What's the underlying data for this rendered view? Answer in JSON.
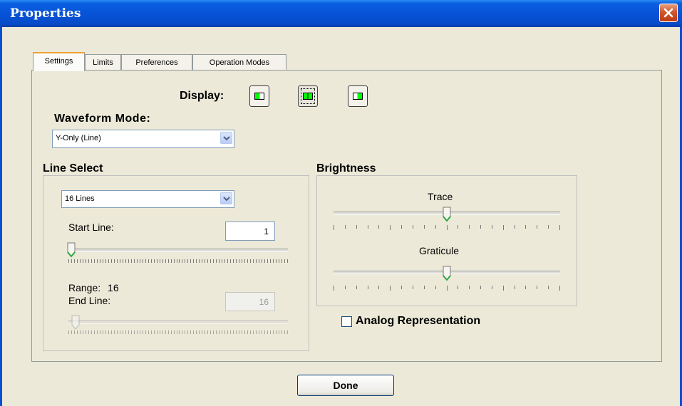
{
  "window": {
    "title": "Properties"
  },
  "tabs": [
    {
      "label": "Settings",
      "active": true
    },
    {
      "label": "Limits",
      "active": false
    },
    {
      "label": "Preferences",
      "active": false
    },
    {
      "label": "Operation Modes",
      "active": false
    }
  ],
  "display": {
    "label": "Display:",
    "options": [
      {
        "icon": "display-left-icon",
        "selected": false
      },
      {
        "icon": "display-split-icon",
        "selected": true
      },
      {
        "icon": "display-right-icon",
        "selected": false
      }
    ]
  },
  "waveform_mode": {
    "label": "Waveform Mode:",
    "value": "Y-Only (Line)"
  },
  "line_select": {
    "label": "Line Select",
    "combo_value": "16 Lines",
    "start_line_label": "Start Line:",
    "start_line_value": "1",
    "range_label": "Range:",
    "range_value": "16",
    "end_line_label": "End Line:",
    "end_line_value": "16",
    "start_slider_fraction": 0.0,
    "end_slider_fraction": 0.0
  },
  "brightness": {
    "label": "Brightness",
    "trace_label": "Trace",
    "trace_fraction": 0.5,
    "graticule_label": "Graticule",
    "graticule_fraction": 0.5
  },
  "analog": {
    "label": "Analog Representation",
    "checked": false
  },
  "done_label": "Done",
  "colors": {
    "titlebar": "#0753D8",
    "display_screen": "#00FF00",
    "tab_highlight": "#F0A030"
  }
}
